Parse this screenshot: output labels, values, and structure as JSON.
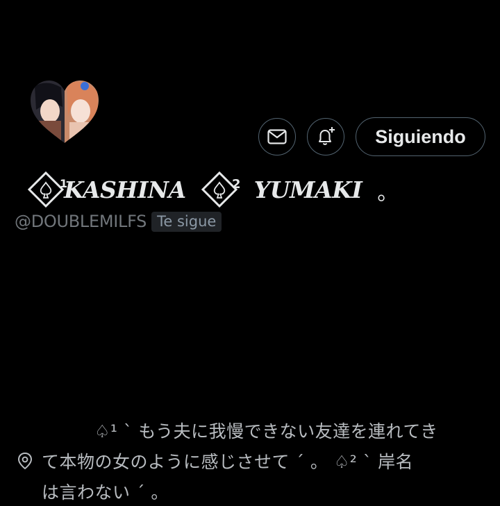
{
  "profile": {
    "avatar_icon": "heart-avatar-icon",
    "display_name": {
      "part1_sup": "1",
      "part1": "KASHINA",
      "part2_sup": "2",
      "part2": "YUMAKI",
      "ending": "。"
    },
    "handle": "@DOUBLEMILFS",
    "follows_you_badge": "Te sigue"
  },
  "actions": {
    "message_icon": "envelope-icon",
    "notify_icon": "bell-plus-icon",
    "following_label": "Siguiendo"
  },
  "bio": {
    "line1": "♤¹ ˋ もう夫に我慢できない友達を連れてき",
    "line2": "て本物の女のように感じさせて ˊ 。  ♤² ˋ 岸名",
    "line3": "は言わない ˊ 。",
    "location_icon": "location-pin-icon"
  },
  "colors": {
    "background": "#000000",
    "text_primary": "#e7e9ea",
    "text_secondary": "#71767b",
    "border": "#536471",
    "badge_bg": "#202327"
  }
}
